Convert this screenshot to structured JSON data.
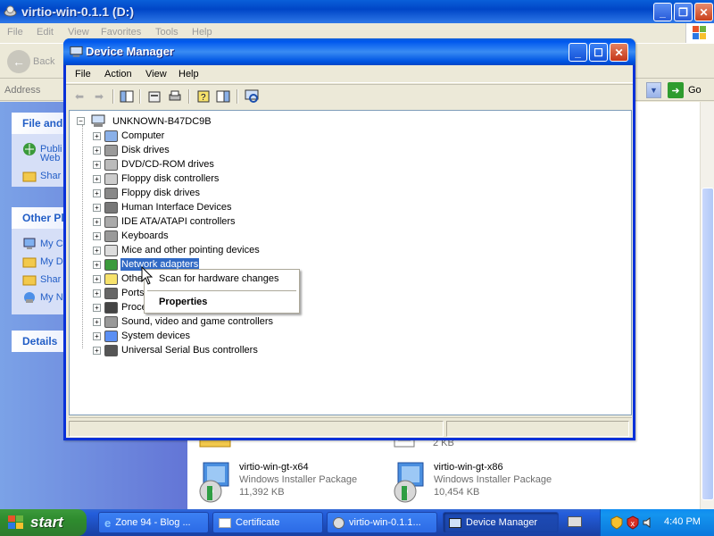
{
  "explorer": {
    "title": "virtio-win-0.1.1 (D:)",
    "menu": [
      "File",
      "Edit",
      "View",
      "Favorites",
      "Tools",
      "Help"
    ],
    "back_label": "Back",
    "address_label": "Address",
    "go_label": "Go",
    "panels": {
      "file_folder_tasks": {
        "header": "File and",
        "items": [
          "Publi",
          "Web",
          "Shar"
        ]
      },
      "other_places": {
        "header": "Other Pl",
        "items": [
          "My C",
          "My D",
          "Shar",
          "My N"
        ]
      },
      "details": {
        "header": "Details"
      }
    },
    "files": [
      {
        "name": "virtio-win-gt-x64",
        "type": "Windows Installer Package",
        "size": "11,392 KB"
      },
      {
        "name": "virtio-win-gt-x86",
        "type": "Windows Installer Package",
        "size": "10,454 KB"
      }
    ],
    "partial_size": "2 KB"
  },
  "device_manager": {
    "title": "Device Manager",
    "menu": [
      "File",
      "Action",
      "View",
      "Help"
    ],
    "root": "UNKNOWN-B47DC9B",
    "categories": [
      "Computer",
      "Disk drives",
      "DVD/CD-ROM drives",
      "Floppy disk controllers",
      "Floppy disk drives",
      "Human Interface Devices",
      "IDE ATA/ATAPI controllers",
      "Keyboards",
      "Mice and other pointing devices",
      "Network adapters",
      "Othe",
      "Ports",
      "Proce",
      "Sound, video and game controllers",
      "System devices",
      "Universal Serial Bus controllers"
    ],
    "selected": "Network adapters"
  },
  "context_menu": {
    "items": [
      "Scan for hardware changes",
      "Properties"
    ]
  },
  "taskbar": {
    "start": "start",
    "tasks": [
      "Zone 94 - Blog ...",
      "Certificate",
      "virtio-win-0.1.1...",
      "Device Manager"
    ],
    "active_task": "Device Manager",
    "clock": "4:40 PM"
  },
  "colors": {
    "titlebar": "#0058EE",
    "selection": "#316AC5",
    "taskbar": "#245EDC",
    "start": "#2E8B2E"
  }
}
